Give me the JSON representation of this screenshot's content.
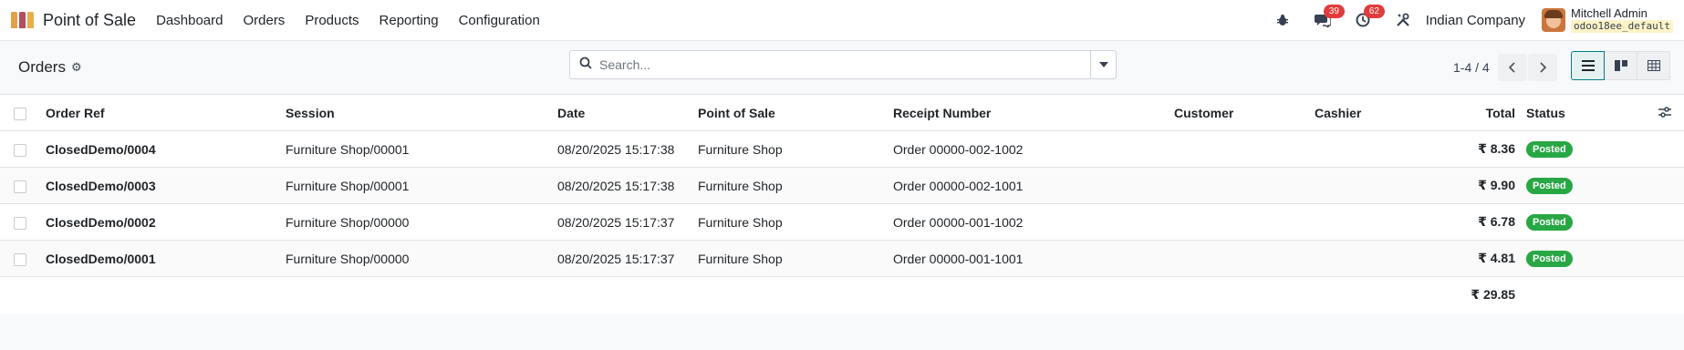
{
  "navbar": {
    "app_name": "Point of Sale",
    "menu": [
      "Dashboard",
      "Orders",
      "Products",
      "Reporting",
      "Configuration"
    ],
    "messages_count": "39",
    "activities_count": "62",
    "company": "Indian Company",
    "user_name": "Mitchell Admin",
    "db_name": "odoo18ee_default"
  },
  "control": {
    "breadcrumb": "Orders",
    "search_placeholder": "Search...",
    "pager": "1-4 / 4"
  },
  "table": {
    "columns": [
      "Order Ref",
      "Session",
      "Date",
      "Point of Sale",
      "Receipt Number",
      "Customer",
      "Cashier",
      "Total",
      "Status"
    ],
    "rows": [
      {
        "ref": "ClosedDemo/0004",
        "session": "Furniture Shop/00001",
        "date": "08/20/2025 15:17:38",
        "pos": "Furniture Shop",
        "receipt": "Order 00000-002-1002",
        "customer": "",
        "cashier": "",
        "total": "₹ 8.36",
        "status": "Posted"
      },
      {
        "ref": "ClosedDemo/0003",
        "session": "Furniture Shop/00001",
        "date": "08/20/2025 15:17:38",
        "pos": "Furniture Shop",
        "receipt": "Order 00000-002-1001",
        "customer": "",
        "cashier": "",
        "total": "₹ 9.90",
        "status": "Posted"
      },
      {
        "ref": "ClosedDemo/0002",
        "session": "Furniture Shop/00000",
        "date": "08/20/2025 15:17:37",
        "pos": "Furniture Shop",
        "receipt": "Order 00000-001-1002",
        "customer": "",
        "cashier": "",
        "total": "₹ 6.78",
        "status": "Posted"
      },
      {
        "ref": "ClosedDemo/0001",
        "session": "Furniture Shop/00000",
        "date": "08/20/2025 15:17:37",
        "pos": "Furniture Shop",
        "receipt": "Order 00000-001-1001",
        "customer": "",
        "cashier": "",
        "total": "₹ 4.81",
        "status": "Posted"
      }
    ],
    "grand_total": "₹ 29.85"
  },
  "colors": {
    "accent": "#017e84",
    "posted": "#28a745",
    "badge": "#e23b3b"
  }
}
